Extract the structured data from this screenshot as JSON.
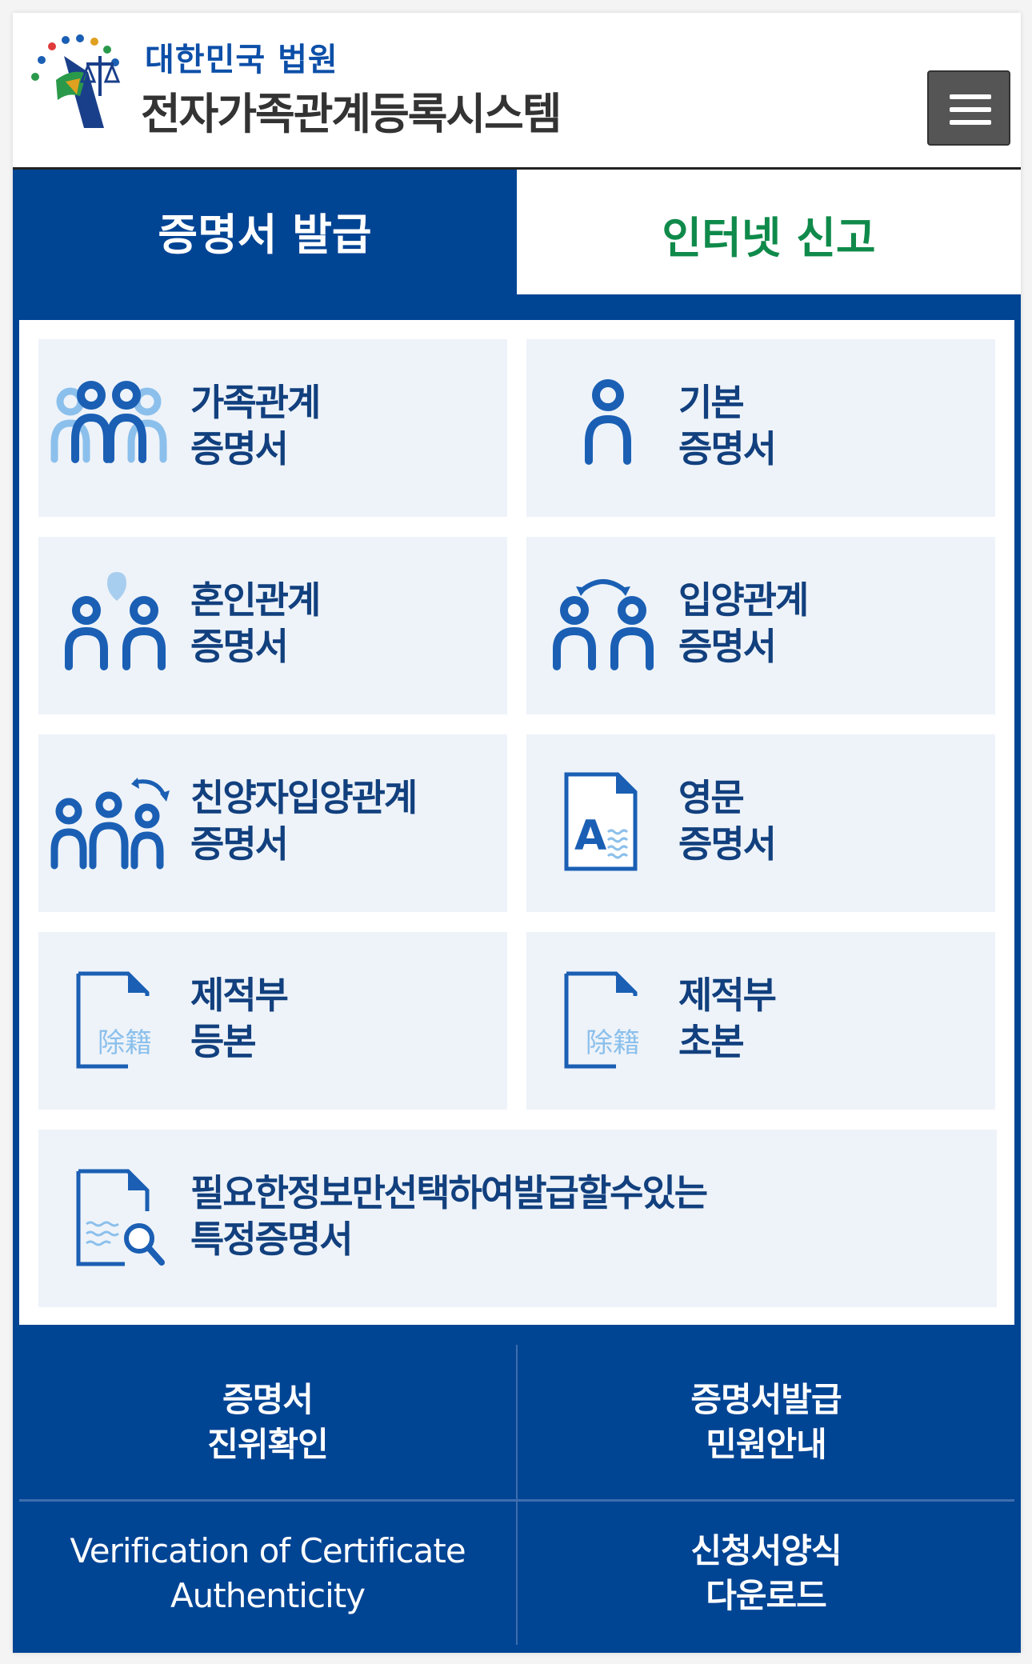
{
  "header": {
    "site_sub": "대한민국 법원",
    "site_title": "전자가족관계등록시스템",
    "logo_icon": "supreme-court-logo",
    "menu_icon": "hamburger-icon"
  },
  "tabs": [
    {
      "label": "증명서 발급",
      "active": true
    },
    {
      "label": "인터넷 신고",
      "active": false
    }
  ],
  "cards": [
    {
      "line1": "가족관계",
      "line2": "증명서",
      "icon": "family-icon"
    },
    {
      "line1": "기본",
      "line2": "증명서",
      "icon": "person-icon"
    },
    {
      "line1": "혼인관계",
      "line2": "증명서",
      "icon": "couple-heart-icon"
    },
    {
      "line1": "입양관계",
      "line2": "증명서",
      "icon": "adoption-icon"
    },
    {
      "line1": "친양자입양관계",
      "line2": "증명서",
      "icon": "full-adoption-icon"
    },
    {
      "line1": "영문",
      "line2": "증명서",
      "icon": "english-document-icon"
    },
    {
      "line1": "제적부",
      "line2": "등본",
      "icon": "removed-register-copy-icon",
      "doc_text": "除籍"
    },
    {
      "line1": "제적부",
      "line2": "초본",
      "icon": "removed-register-abstract-icon",
      "doc_text": "除籍"
    },
    {
      "line1": "필요한정보만선택하여발급할수있는",
      "line2": "특정증명서",
      "icon": "document-search-icon"
    }
  ],
  "bottom_links": [
    {
      "line1": "증명서",
      "line2": "진위확인"
    },
    {
      "line1": "증명서발급",
      "line2": "민원안내"
    },
    {
      "line1": "Verification of Certificate",
      "line2": "Authenticity"
    },
    {
      "line1": "신청서양식",
      "line2": "다운로드"
    }
  ],
  "colors": {
    "primary": "#004494",
    "tab_inactive_text": "#0f8a4a",
    "card_bg": "#eef3f9",
    "card_text": "#12407e",
    "icon_blue": "#1a5fb4",
    "icon_light": "#8cc0ec"
  }
}
